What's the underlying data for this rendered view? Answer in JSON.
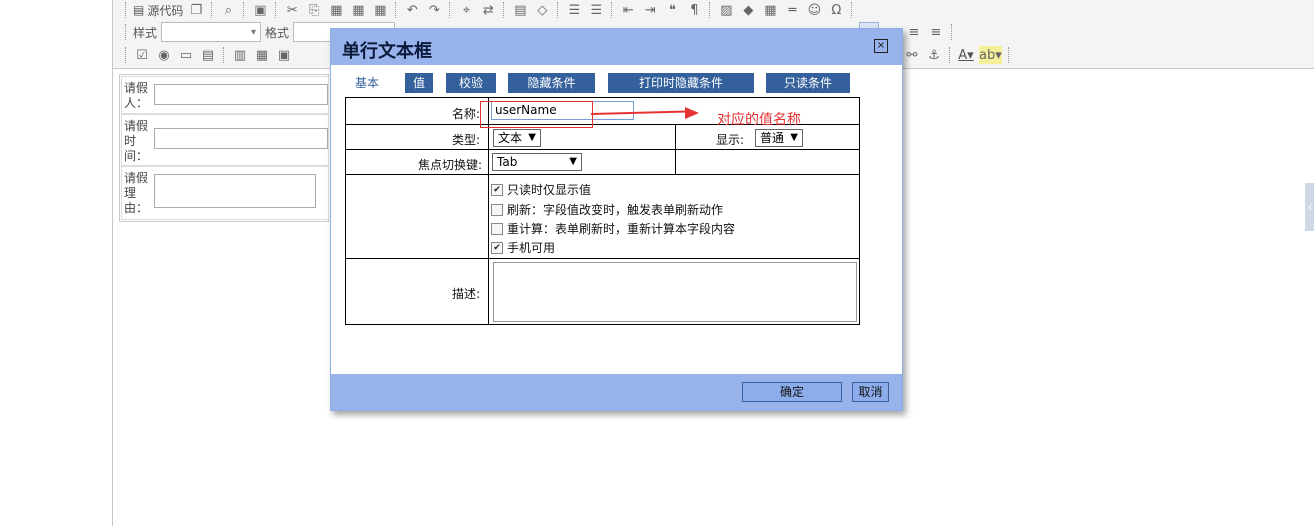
{
  "toolbar": {
    "source_label": "源代码",
    "style_label": "样式",
    "format_label": "格式"
  },
  "form": {
    "rows": [
      {
        "label": "请假人："
      },
      {
        "label": "请假时间："
      },
      {
        "label": "请假理由："
      }
    ]
  },
  "dialog": {
    "title": "单行文本框",
    "close_glyph": "×",
    "tabs": [
      {
        "label": "基本"
      },
      {
        "label": "值"
      },
      {
        "label": "校验"
      },
      {
        "label": "隐藏条件"
      },
      {
        "label": "打印时隐藏条件"
      },
      {
        "label": "只读条件"
      }
    ],
    "name_label": "名称:",
    "name_value": "userName",
    "type_label": "类型:",
    "type_value": "文本",
    "display_label": "显示:",
    "display_value": "普通",
    "focus_label": "焦点切换键:",
    "focus_value": "Tab",
    "checkboxes": [
      {
        "label": "只读时仅显示值",
        "checked": true
      },
      {
        "label": "刷新：字段值改变时，触发表单刷新动作",
        "checked": false
      },
      {
        "label": "重计算：表单刷新时，重新计算本字段内容",
        "checked": false
      },
      {
        "label": "手机可用",
        "checked": true
      }
    ],
    "description_label": "描述:",
    "ok_label": "确定",
    "cancel_label": "取消"
  },
  "annotation": {
    "text": "对应的值名称",
    "color": "#e53333"
  },
  "colors": {
    "dialog_header": "#98b3ec",
    "tab_bg": "#34609c"
  }
}
